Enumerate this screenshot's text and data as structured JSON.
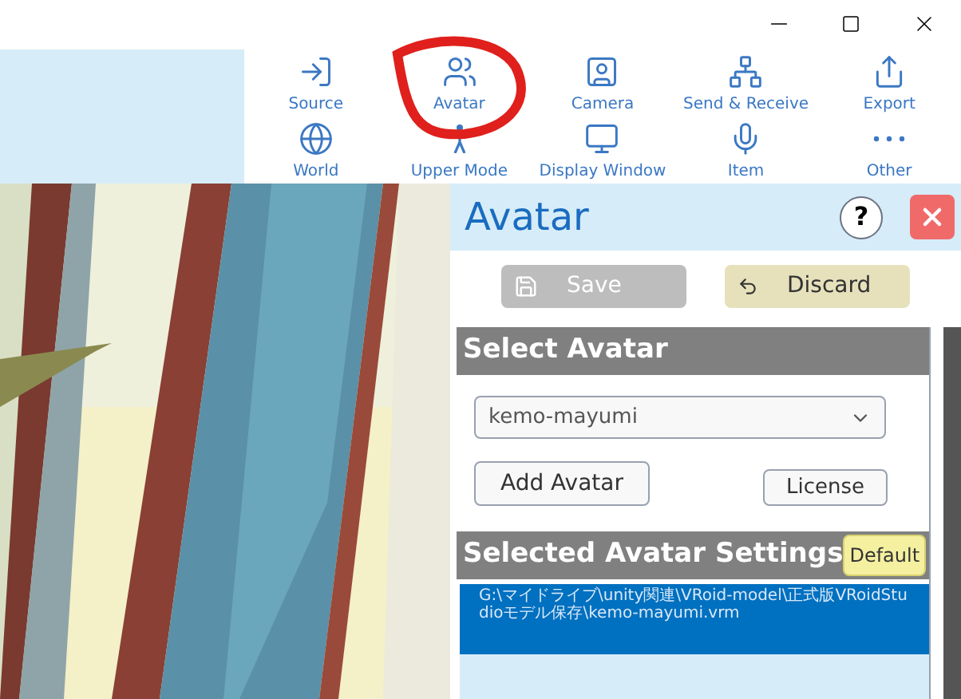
{
  "toolbar": {
    "items": [
      {
        "label": "Source"
      },
      {
        "label": "Avatar"
      },
      {
        "label": "Camera"
      },
      {
        "label": "Send & Receive"
      },
      {
        "label": "Export"
      },
      {
        "label": "World"
      },
      {
        "label": "Upper Mode"
      },
      {
        "label": "Display Window"
      },
      {
        "label": "Item"
      },
      {
        "label": "Other"
      }
    ]
  },
  "panel": {
    "title": "Avatar",
    "help": "?",
    "buttons": [
      {
        "label": "Save",
        "disabled": true
      },
      {
        "label": "Discard",
        "disabled": false
      }
    ],
    "select_section": {
      "title": "Select Avatar",
      "dropdown": {
        "value": "kemo-mayumi"
      },
      "add_button": "Add Avatar",
      "license_button": "License"
    },
    "settings_section": {
      "title": "Selected Avatar Settings",
      "default_button": "Default",
      "path": "G:\\マイドライブ\\unity関連\\VRoid-model\\正式版VRoidStudioモデル保存\\kemo-mayumi.vrm"
    }
  }
}
